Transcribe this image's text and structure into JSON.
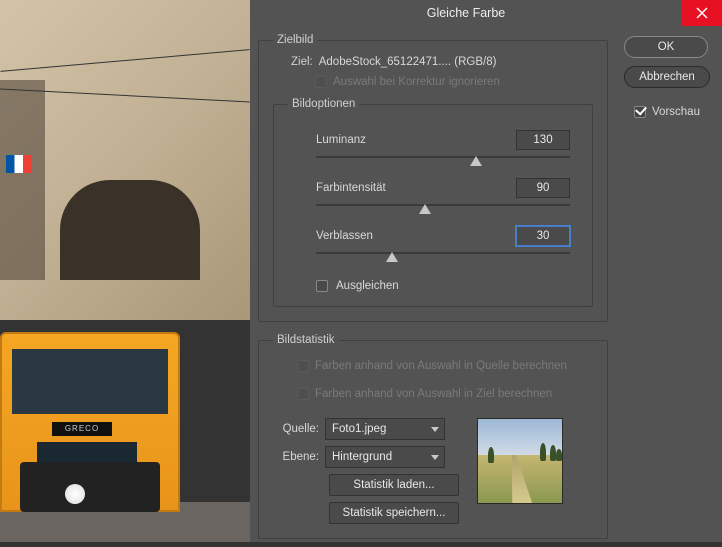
{
  "titlebar": {
    "title": "Gleiche Farbe"
  },
  "sidebar": {
    "ok": "OK",
    "cancel": "Abbrechen",
    "preview": "Vorschau"
  },
  "zielbild": {
    "legend": "Zielbild",
    "ziel_label": "Ziel:",
    "ziel_value": "AdobeStock_65122471.... (RGB/8)",
    "ignore": "Auswahl bei Korrektur ignorieren",
    "bildoptionen": "Bildoptionen",
    "luminanz": {
      "label": "Luminanz",
      "value": "130"
    },
    "farbintensitat": {
      "label": "Farbintensität",
      "value": "90"
    },
    "verblassen": {
      "label": "Verblassen",
      "value": "30"
    },
    "ausgleichen": "Ausgleichen"
  },
  "statistik": {
    "legend": "Bildstatistik",
    "from_source": "Farben anhand von Auswahl in Quelle berechnen",
    "from_target": "Farben anhand von Auswahl in Ziel berechnen",
    "quelle_label": "Quelle:",
    "quelle_value": "Foto1.jpeg",
    "ebene_label": "Ebene:",
    "ebene_value": "Hintergrund",
    "load": "Statistik laden...",
    "save": "Statistik speichern..."
  },
  "tram_sign": "GRECO"
}
